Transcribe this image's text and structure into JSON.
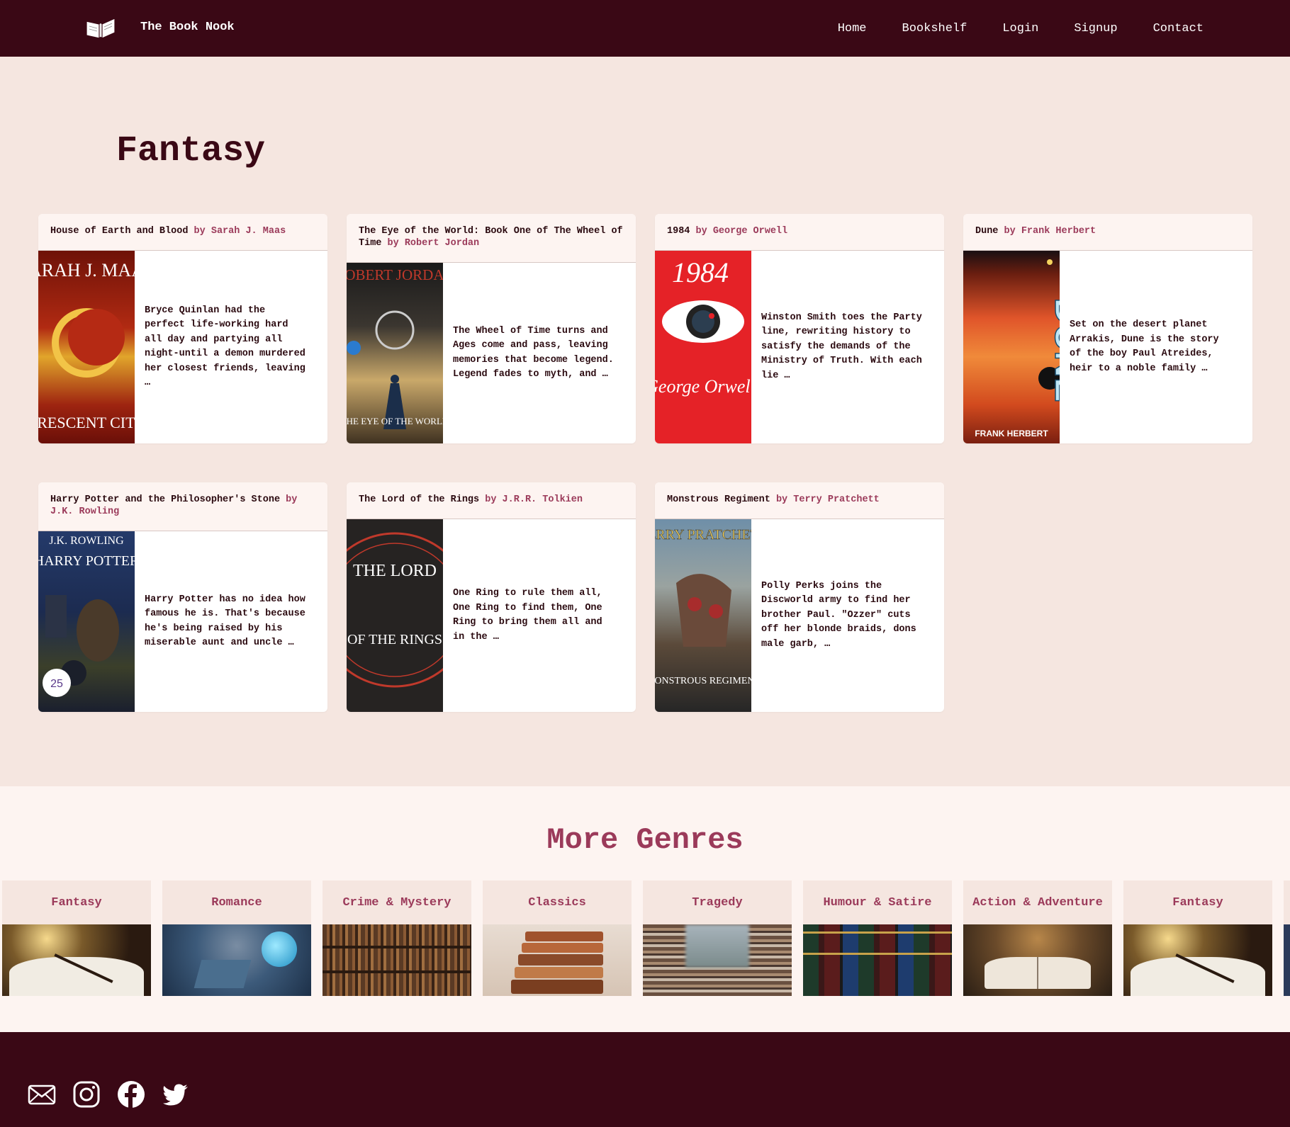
{
  "nav": {
    "brand": "The Book Nook",
    "links": [
      "Home",
      "Bookshelf",
      "Login",
      "Signup",
      "Contact"
    ]
  },
  "page_title": "Fantasy",
  "books": [
    {
      "title": "House of Earth and Blood",
      "by": "by Sarah J. Maas",
      "blurb": "Bryce Quinlan had the perfect life-working hard all day and partying all night-until a demon murdered her closest friends, leaving …",
      "cover": {
        "top": "SARAH J. MAAS",
        "bottom": "CRESCENT CITY"
      }
    },
    {
      "title": "The Eye of the World: Book One of The Wheel of Time",
      "by": "by Robert Jordan",
      "blurb": "The Wheel of Time turns and Ages come and pass, leaving memories that become legend. Legend fades to myth, and …",
      "cover": {
        "top": "ROBERT JORDAN",
        "bottom": "THE EYE OF THE WORLD"
      }
    },
    {
      "title": "1984",
      "by": "by George Orwell",
      "blurb": "Winston Smith toes the Party line, rewriting history to satisfy the demands of the Ministry of Truth. With each lie …",
      "cover": {
        "top": "1984",
        "bottom": "George Orwell"
      }
    },
    {
      "title": "Dune",
      "by": "by Frank Herbert",
      "blurb": "Set on the desert planet Arrakis, Dune is the story of the boy Paul Atreides, heir to a noble family …",
      "cover": {
        "top": "DUNE",
        "bottom": "FRANK HERBERT"
      }
    },
    {
      "title": "Harry Potter and the Philosopher's Stone",
      "by": "by J.K. Rowling",
      "blurb": "Harry Potter has no idea how famous he is. That's because he's being raised by his miserable aunt and uncle …",
      "cover": {
        "top": "J.K. ROWLING",
        "bottom": "HARRY POTTER"
      }
    },
    {
      "title": "The Lord of the Rings",
      "by": "by J.R.R. Tolkien",
      "blurb": "One Ring to rule them all, One Ring to find them, One Ring to bring them all and in the …",
      "cover": {
        "top": "THE LORD",
        "bottom": "OF THE RINGS"
      }
    },
    {
      "title": "Monstrous Regiment",
      "by": "by Terry Pratchett",
      "blurb": "Polly Perks joins the Discworld army to find her brother Paul. \"Ozzer\" cuts off her blonde braids, dons male garb, …",
      "cover": {
        "top": "TERRY PRATCHETT",
        "bottom": "MONSTROUS REGIMENT"
      }
    }
  ],
  "more_genres": {
    "title": "More Genres",
    "items": [
      "Fantasy",
      "Romance",
      "Crime & Mystery",
      "Classics",
      "Tragedy",
      "Humour & Satire",
      "Action & Adventure",
      "Fantasy"
    ]
  },
  "footer": {
    "icons": [
      "mail-icon",
      "instagram-icon",
      "facebook-icon",
      "twitter-icon"
    ]
  },
  "colors": {
    "nav_bg": "#3a0815",
    "page_bg": "#f5e6e0",
    "accent": "#9b3a5a"
  }
}
